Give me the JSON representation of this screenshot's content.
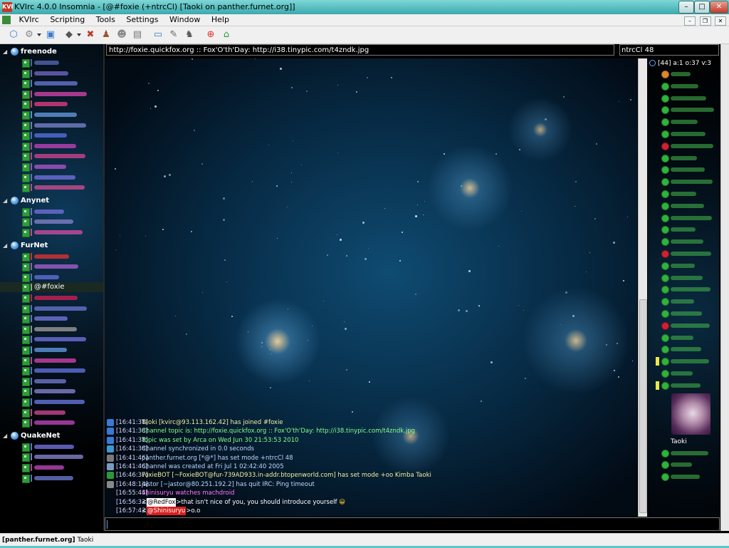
{
  "window": {
    "title": "KVIrc 4.0.0 Insomnia - [@#foxie (+ntrcCl) [Taoki on panther.furnet.org]]",
    "app_icon_text": "KVI",
    "buttons": {
      "minimize": "–",
      "maximize": "□",
      "close": "✕"
    }
  },
  "menu": {
    "items": [
      "KVIrc",
      "Scripting",
      "Tools",
      "Settings",
      "Window",
      "Help"
    ],
    "mdi_buttons": {
      "minimize": "–",
      "restore": "❐",
      "close": "✕"
    }
  },
  "toolbar": {
    "icons": [
      "new-connection-icon",
      "server-options-icon",
      "window-icon",
      "identity-icon",
      "tools-icon",
      "user-icon",
      "avatar-icon",
      "address-book-icon",
      "browse-icon",
      "configure-icon",
      "file-transfer-icon",
      "help-icon",
      "homepage-icon"
    ]
  },
  "tree": {
    "networks": [
      {
        "name": "freenode",
        "channels": [
          {
            "color": "#4f5fa5"
          },
          {
            "color": "#6a5fb5"
          },
          {
            "color": "#5f6fc5"
          },
          {
            "color": "#c040a0"
          },
          {
            "color": "#d03a7a"
          },
          {
            "color": "#5a8fd0"
          },
          {
            "color": "#6f7ac0"
          },
          {
            "color": "#4f6ad0"
          },
          {
            "color": "#b040b0"
          },
          {
            "color": "#c0408a"
          },
          {
            "color": "#a050c0"
          },
          {
            "color": "#6a6ad0"
          },
          {
            "color": "#c04a8a"
          }
        ]
      },
      {
        "name": "Anynet",
        "channels": [
          {
            "color": "#6a6ad0"
          },
          {
            "color": "#7a7ac0"
          },
          {
            "color": "#c04a9a"
          }
        ]
      },
      {
        "name": "FurNet",
        "channels": [
          {
            "color": "#d03030"
          },
          {
            "color": "#9a5ac0"
          },
          {
            "color": "#5a6ad0"
          },
          {
            "label": "@#foxie",
            "selected": true
          },
          {
            "color": "#c02050"
          },
          {
            "color": "#5f6fc0"
          },
          {
            "color": "#6a6fd0"
          },
          {
            "color": "#909090"
          },
          {
            "color": "#6a6ad0"
          },
          {
            "color": "#5a8fd0"
          },
          {
            "color": "#c040a0"
          },
          {
            "color": "#5a6ad0"
          },
          {
            "color": "#6a6fc0"
          },
          {
            "color": "#7a7ac0"
          },
          {
            "color": "#5f6fd0"
          },
          {
            "color": "#c0408a"
          },
          {
            "color": "#b040b0"
          }
        ]
      },
      {
        "name": "QuakeNet",
        "channels": [
          {
            "color": "#6a6ad0"
          },
          {
            "color": "#7a7ac0"
          },
          {
            "color": "#b040b0"
          },
          {
            "color": "#5f6fc0"
          }
        ]
      }
    ]
  },
  "topic": "http://foxie.quickfox.org :: Fox'O'th'Day: http://i38.tinypic.com/t4zndk.jpg",
  "mode": "ntrcCl 48",
  "chat": {
    "lines": [
      {
        "icon": "join-icon",
        "icon_color": "#3a7ad0",
        "ts": "[16:41:38]",
        "text": "Taoki [kvirc@93.113.162.42] has joined #foxie",
        "cls": "c-yellow"
      },
      {
        "icon": "topic-icon",
        "icon_color": "#3a7ad0",
        "ts": "[16:41:38]",
        "text": "Channel topic is: http://foxie.quickfox.org :: Fox'O'th'Day: http://i38.tinypic.com/t4zndk.jpg",
        "cls": "c-green"
      },
      {
        "icon": "topic-icon",
        "icon_color": "#3a7ad0",
        "ts": "[16:41:38]",
        "text": "Topic was set by Arca on Wed Jun 30 21:53:53 2010",
        "cls": "c-green"
      },
      {
        "icon": "sync-icon",
        "icon_color": "#3a9ad0",
        "ts": "[16:41:38]",
        "text": "Channel synchronized in 0.0 seconds",
        "cls": "c-lblue"
      },
      {
        "icon": "mode-icon",
        "icon_color": "#7a7a7a",
        "ts": "[16:41:46]",
        "text": "panther.furnet.org [*@*] has set mode +ntrcCl 48",
        "cls": "c-lblue"
      },
      {
        "icon": "clock-icon",
        "icon_color": "#7a9ac0",
        "ts": "[16:41:46]",
        "text": "Channel was created at Fri Jul 1 02:42:40 2005",
        "cls": "c-lblue"
      },
      {
        "icon": "op-icon",
        "icon_color": "#2a9a3a",
        "ts": "[16:46:37]",
        "text": "FoxieBOT [~FoxieBOT@fur-739AD933.in-addr.btopenworld.com] has set mode +oo Kimba Taoki",
        "cls": "c-yellow"
      },
      {
        "icon": "quit-icon",
        "icon_color": "#888",
        "ts": "[16:48:14]",
        "text": "jastor [~jastor@80.251.192.2] has quit IRC: Ping timeout",
        "cls": "c-lblue"
      },
      {
        "icon": "",
        "icon_color": "",
        "ts": "[16:55:44]",
        "text": "Shinisuryu watches machdroid",
        "cls": "c-pink"
      },
      {
        "icon": "",
        "icon_color": "",
        "ts": "[16:56:32]",
        "nick": "@RedFox",
        "nick_bg": "#ffffff",
        "nick_fg": "#000",
        "text": "that isn't nice of you, you should introduce yourself",
        "cls": "c-white",
        "smiley": "😀"
      },
      {
        "icon": "",
        "icon_color": "",
        "ts": "[16:57:42]",
        "nick": "@Shinisuryu",
        "nick_bg": "#d82020",
        "nick_fg": "#fff",
        "text": "o.o",
        "cls": "c-white"
      }
    ]
  },
  "userlist": {
    "header": "[44] a:1 o:37 v:3",
    "users": [
      {
        "type": "a"
      },
      {
        "type": "op"
      },
      {
        "type": "op"
      },
      {
        "type": "op"
      },
      {
        "type": "op"
      },
      {
        "type": "op"
      },
      {
        "type": "red"
      },
      {
        "type": "op"
      },
      {
        "type": "op"
      },
      {
        "type": "op"
      },
      {
        "type": "op"
      },
      {
        "type": "op"
      },
      {
        "type": "op"
      },
      {
        "type": "op"
      },
      {
        "type": "op"
      },
      {
        "type": "red"
      },
      {
        "type": "op"
      },
      {
        "type": "op"
      },
      {
        "type": "op"
      },
      {
        "type": "op"
      },
      {
        "type": "op"
      },
      {
        "type": "red"
      },
      {
        "type": "op"
      },
      {
        "type": "op"
      },
      {
        "type": "op",
        "mark": true
      },
      {
        "type": "op"
      },
      {
        "type": "op",
        "mark": true
      },
      {
        "type": "op"
      },
      {
        "type": "op"
      },
      {
        "type": "op"
      }
    ],
    "avatar_user": "Taoki",
    "after_users": 3
  },
  "status": {
    "server": "[panther.furnet.org]",
    "nick": "Taoki"
  }
}
